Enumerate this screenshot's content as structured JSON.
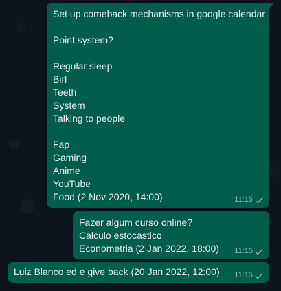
{
  "messages": [
    {
      "lines": [
        "Set up comeback mechanisms in google calendar",
        "",
        "Point system?",
        "",
        "Regular sleep",
        "Birl",
        "Teeth",
        "System",
        "Talking to people",
        "",
        "Fap",
        "Gaming",
        "Anime",
        "YouTube",
        "Food (2 Nov 2020, 14:00)"
      ],
      "time": "11:15",
      "status": "sent"
    },
    {
      "lines": [
        "Fazer algum curso online?",
        "Calculo estocastico",
        "Econometria (2 Jan 2022, 18:00)"
      ],
      "time": "11:15",
      "status": "sent"
    },
    {
      "lines": [
        "Luiz Blanco ed e give back (20 Jan 2022, 12:00)"
      ],
      "time": "11:15",
      "status": "sent"
    }
  ],
  "theme": {
    "outgoing_bubble": "#005c4b",
    "background": "#0b141a",
    "text": "#e9edef"
  }
}
